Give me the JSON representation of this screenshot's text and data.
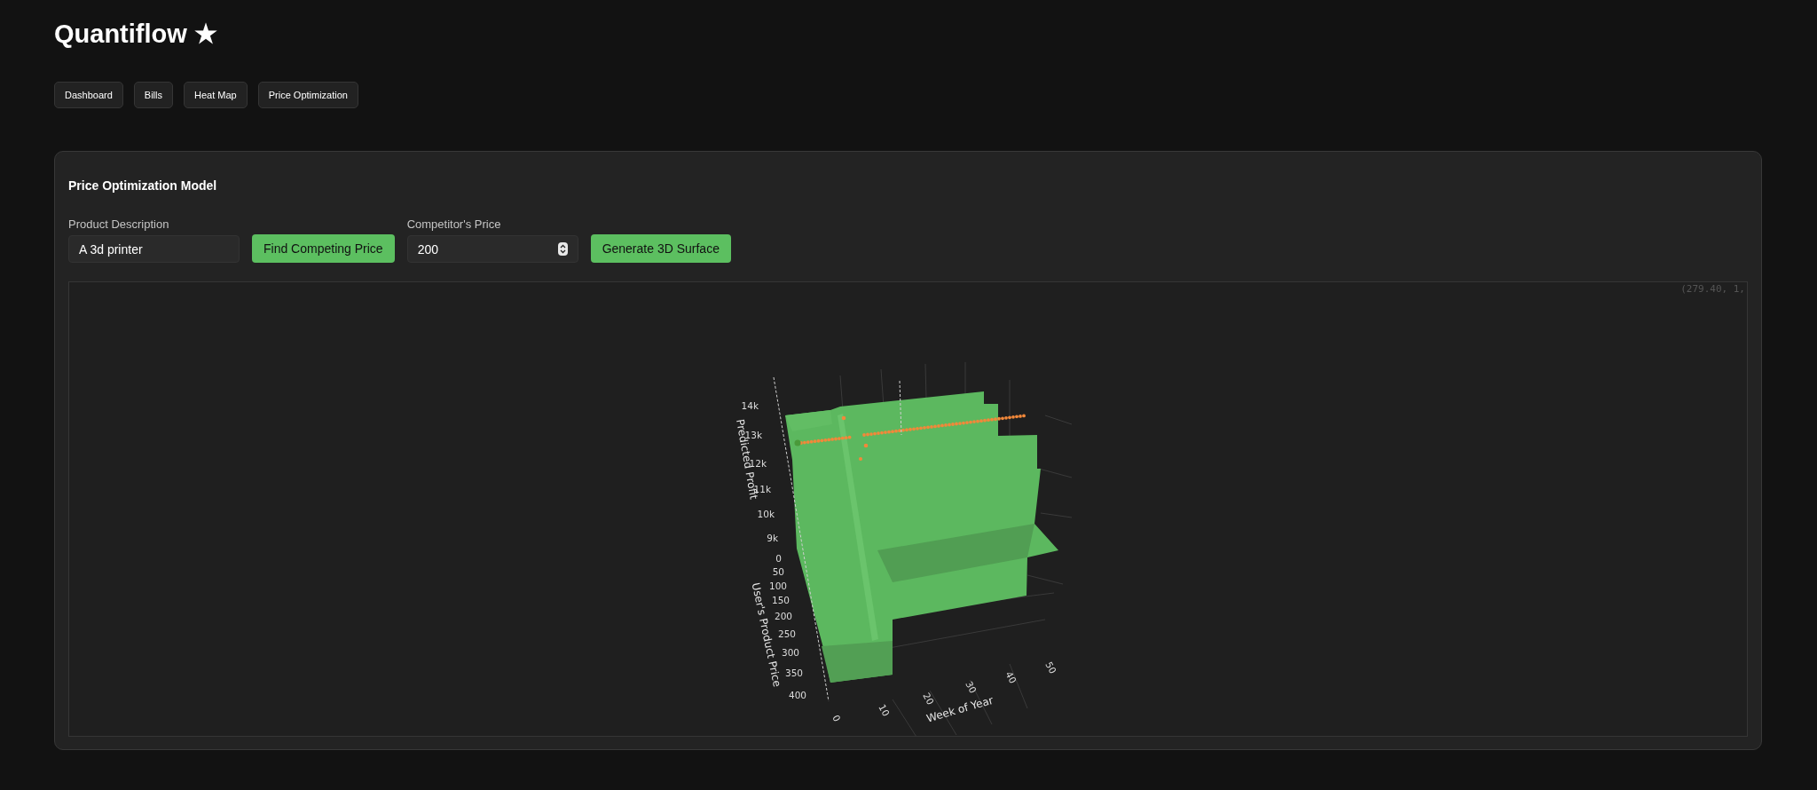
{
  "app": {
    "title": "Quantiflow ★"
  },
  "nav": [
    {
      "label": "Dashboard"
    },
    {
      "label": "Bills"
    },
    {
      "label": "Heat Map"
    },
    {
      "label": "Price Optimization"
    }
  ],
  "panel": {
    "title": "Price Optimization Model",
    "product_description": {
      "label": "Product Description",
      "value": "A 3d printer"
    },
    "find_button": "Find Competing Price",
    "competitor_price": {
      "label": "Competitor's Price",
      "value": "200"
    },
    "generate_button": "Generate 3D Surface",
    "plot": {
      "hover_text": "(279.40, 1,",
      "z_axis": {
        "title": "Predicted Profit",
        "ticks": [
          "14k",
          "13k",
          "12k",
          "11k",
          "10k",
          "9k"
        ]
      },
      "y_axis": {
        "title": "User's Product Price",
        "ticks": [
          "0",
          "50",
          "100",
          "150",
          "200",
          "250",
          "300",
          "350",
          "400"
        ]
      },
      "x_axis": {
        "title": "Week of Year",
        "ticks": [
          "0",
          "10",
          "20",
          "30",
          "40",
          "50"
        ]
      }
    }
  }
}
